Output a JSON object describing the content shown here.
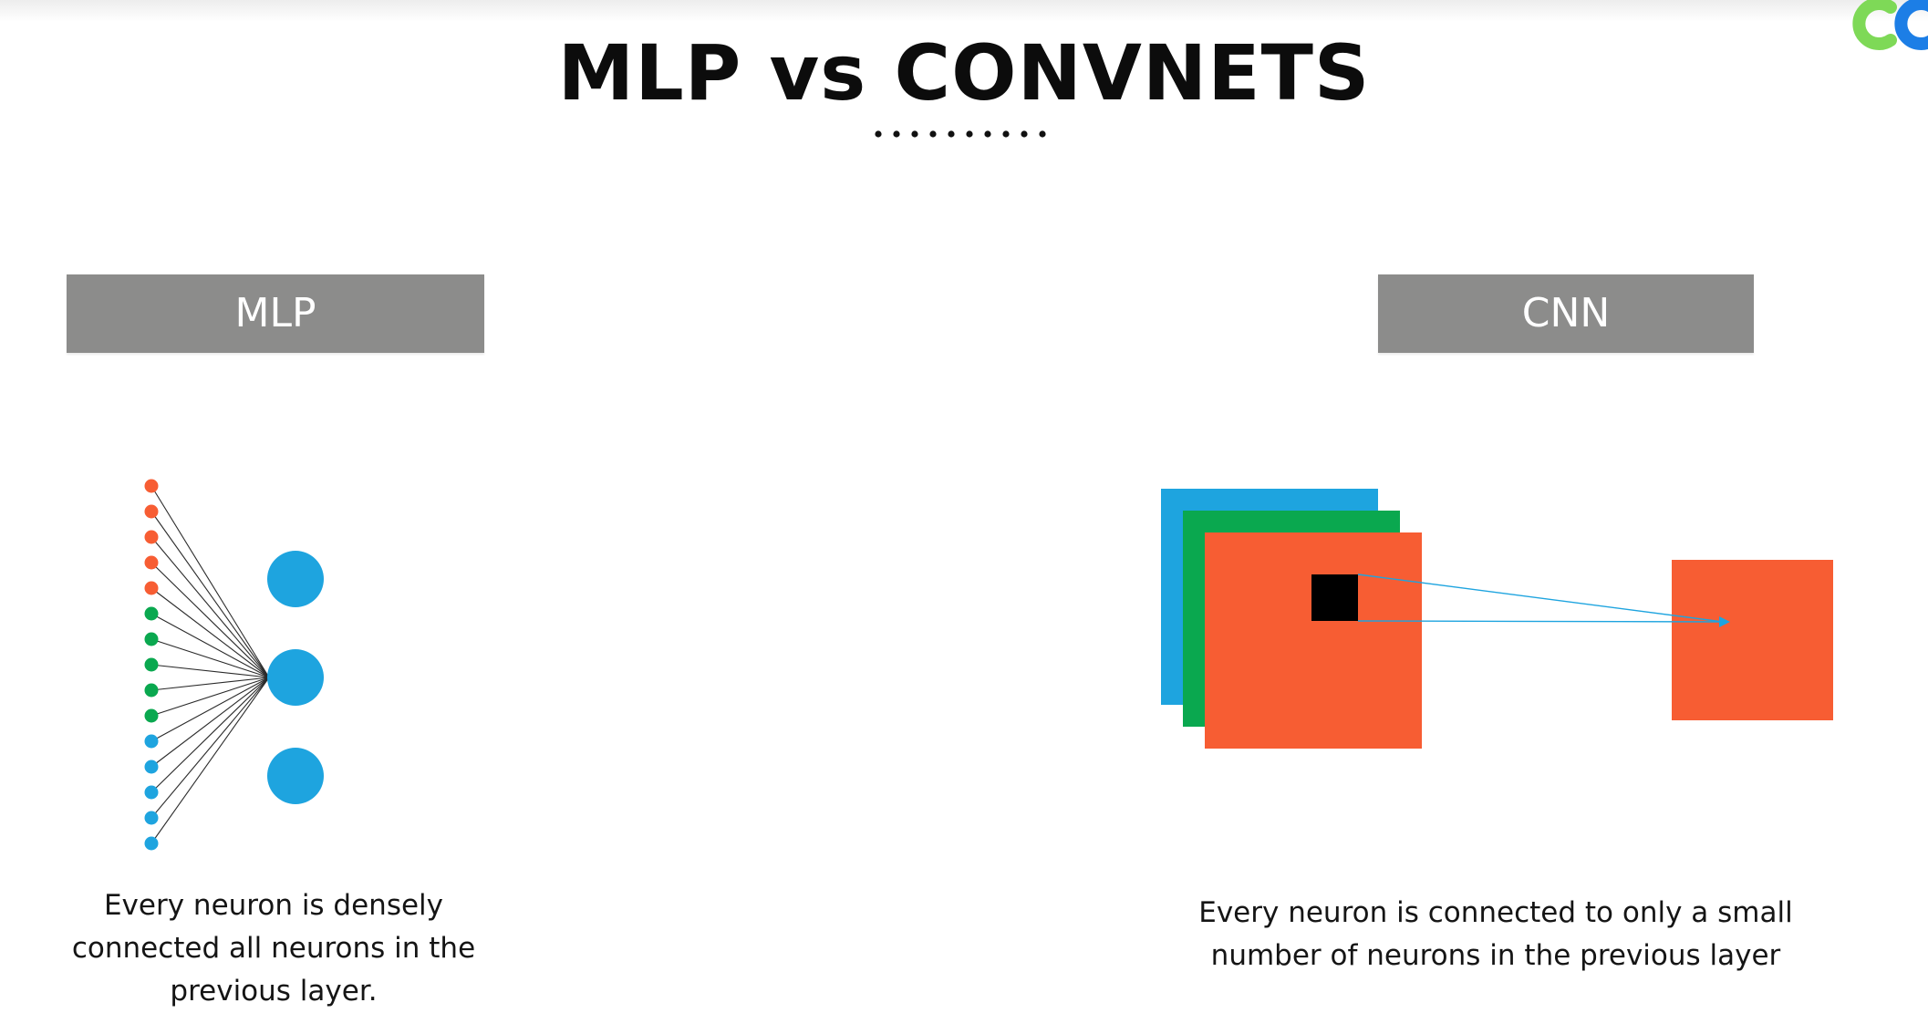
{
  "title": "MLP vs CONVNETS",
  "left_panel": {
    "label": "MLP",
    "caption": "Every neuron is densely connected all neurons in the previous layer.",
    "input_neurons": [
      "orange",
      "orange",
      "orange",
      "orange",
      "orange",
      "green",
      "green",
      "green",
      "green",
      "green",
      "blue",
      "blue",
      "blue",
      "blue",
      "blue"
    ],
    "output_neuron_count": 3,
    "connected_output_index": 1
  },
  "right_panel": {
    "label": "CNN",
    "caption": "Every neuron is connected to only a small number of neurons in the previous layer",
    "input_channels": [
      "blue",
      "green",
      "orange"
    ],
    "receptive_field_arrow_count": 2
  },
  "colors": {
    "orange": "#f75d33",
    "green": "#0aa84f",
    "blue": "#1ea4df",
    "neuron": "#1ea4df",
    "banner": "#8c8c8b",
    "kernel": "#000000",
    "logo_green": "#7ed957",
    "logo_blue": "#1c7ee6"
  }
}
